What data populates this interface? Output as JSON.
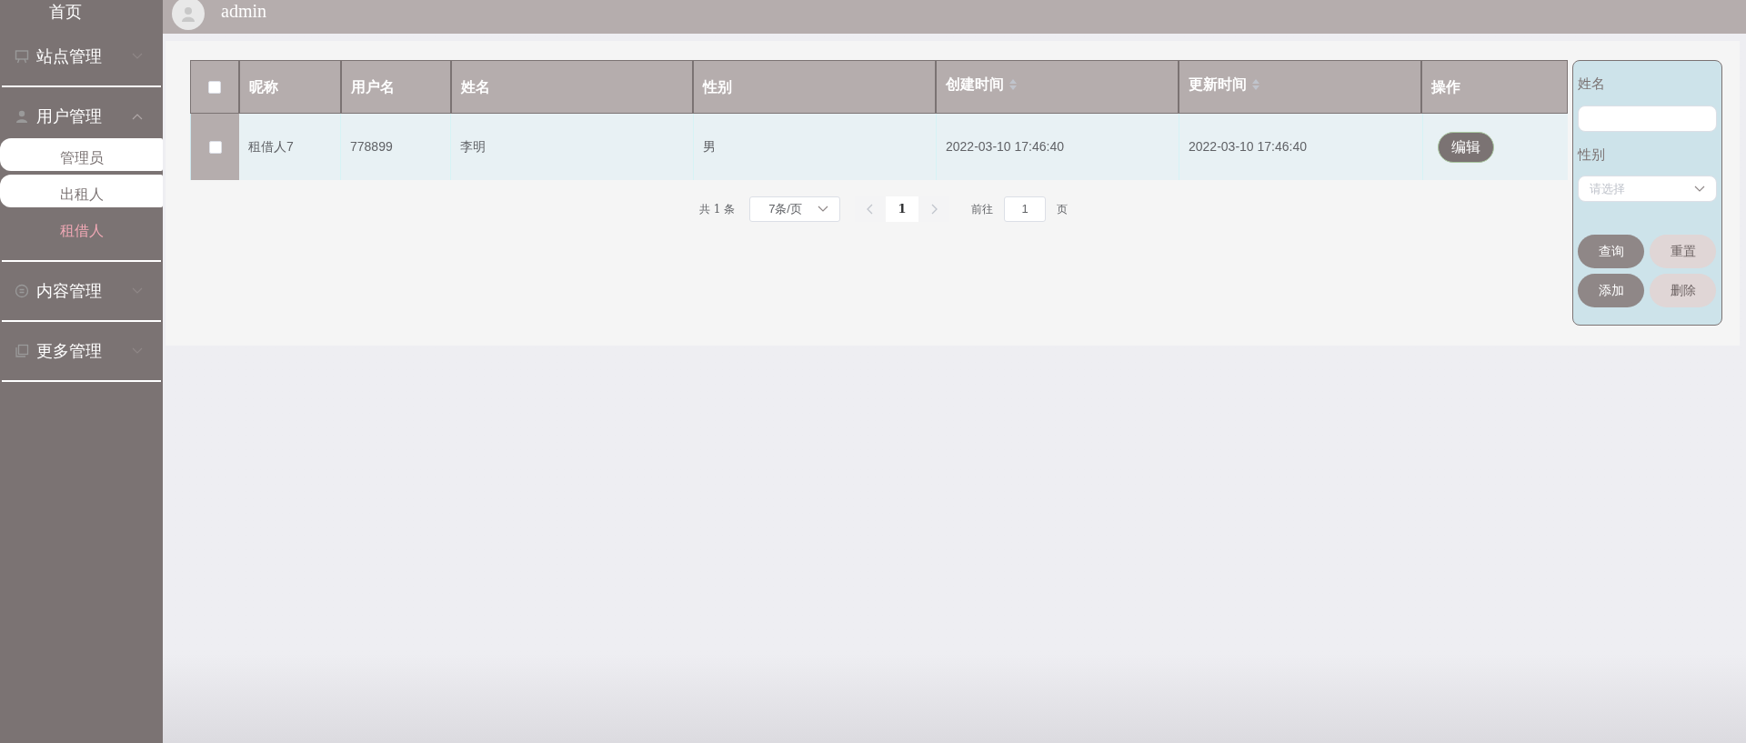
{
  "sidebar": {
    "items": [
      {
        "label": "首页"
      },
      {
        "label": "站点管理",
        "expanded": false
      },
      {
        "label": "用户管理",
        "expanded": true,
        "children": [
          {
            "label": "管理员",
            "highlighted": true,
            "selected": false
          },
          {
            "label": "出租人",
            "highlighted": true,
            "selected": false
          },
          {
            "label": "租借人",
            "highlighted": false,
            "selected": true
          }
        ]
      },
      {
        "label": "内容管理",
        "expanded": false
      },
      {
        "label": "更多管理",
        "expanded": false
      }
    ]
  },
  "header": {
    "user": "admin"
  },
  "table": {
    "select_all_checked": false,
    "columns": [
      {
        "label": "昵称",
        "sortable": false
      },
      {
        "label": "用户名",
        "sortable": false
      },
      {
        "label": "姓名",
        "sortable": false
      },
      {
        "label": "性别",
        "sortable": false
      },
      {
        "label": "创建时间",
        "sortable": true
      },
      {
        "label": "更新时间",
        "sortable": true
      },
      {
        "label": "操作",
        "sortable": false
      }
    ],
    "rows": [
      {
        "checked": false,
        "cells": [
          "租借人7",
          "778899",
          "李明",
          "男",
          "2022-03-10 17:46:40",
          "2022-03-10 17:46:40"
        ],
        "action": "编辑"
      }
    ]
  },
  "pagination": {
    "total": "共 1 条",
    "page_size": "7条/页",
    "current_page": "1",
    "goto_label": "前往",
    "goto_value": "1",
    "page_suffix": "页"
  },
  "search_panel": {
    "fields": [
      {
        "label": "姓名",
        "kind": "text"
      },
      {
        "label": "性别",
        "kind": "select",
        "placeholder": "请选择"
      }
    ],
    "buttons": [
      {
        "label": "查询",
        "kind": "primary"
      },
      {
        "label": "重置",
        "kind": "muted"
      },
      {
        "label": "添加",
        "kind": "primary"
      },
      {
        "label": "删除",
        "kind": "muted"
      }
    ]
  }
}
